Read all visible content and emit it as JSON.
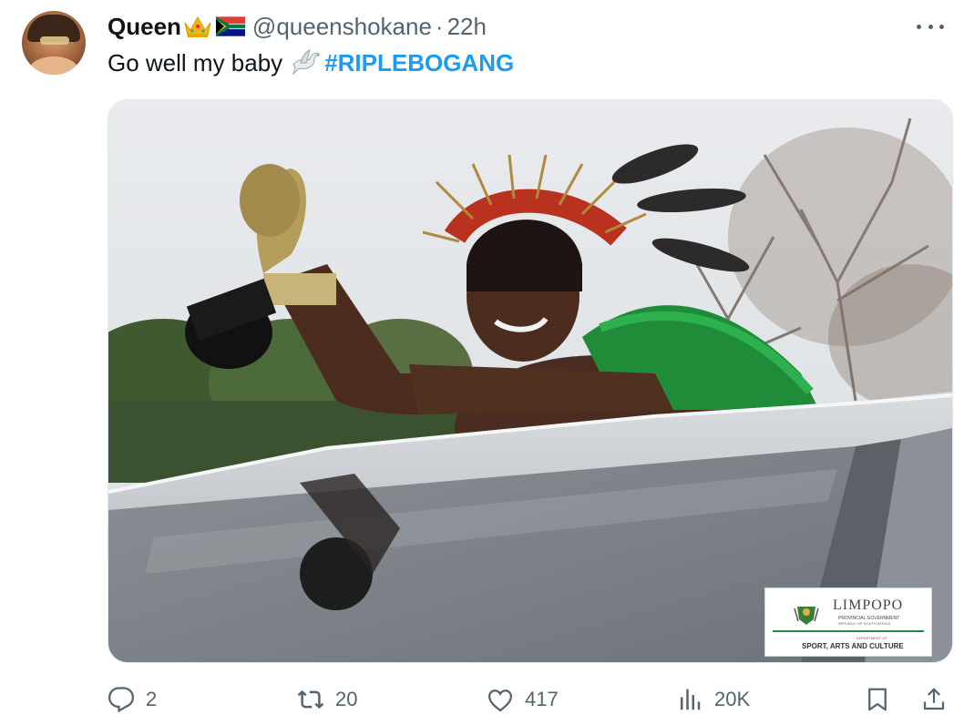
{
  "tweet": {
    "display_name": "Queen",
    "handle": "@queenshokane",
    "separator": "·",
    "time": "22h",
    "text": "Go well my baby",
    "hashtag": "#RIPLEBOGANG"
  },
  "media": {
    "watermark": {
      "title": "LIMPOPO",
      "subtitle": "PROVINCIAL GOVERNMENT",
      "subtitle2": "REPUBLIC OF SOUTH AFRICA",
      "small": "DEPARTMENT OF",
      "department": "SPORT, ARTS AND CULTURE"
    }
  },
  "actions": {
    "replies": "2",
    "retweets": "20",
    "likes": "417",
    "views": "20K"
  },
  "icons": [
    "crown-emoji",
    "south-africa-flag-emoji",
    "dove-emoji",
    "more-icon",
    "reply-icon",
    "retweet-icon",
    "like-icon",
    "views-icon",
    "bookmark-icon",
    "share-icon"
  ],
  "colors": {
    "link": "#1d9bf0",
    "muted": "#536471",
    "text": "#0f1419"
  }
}
